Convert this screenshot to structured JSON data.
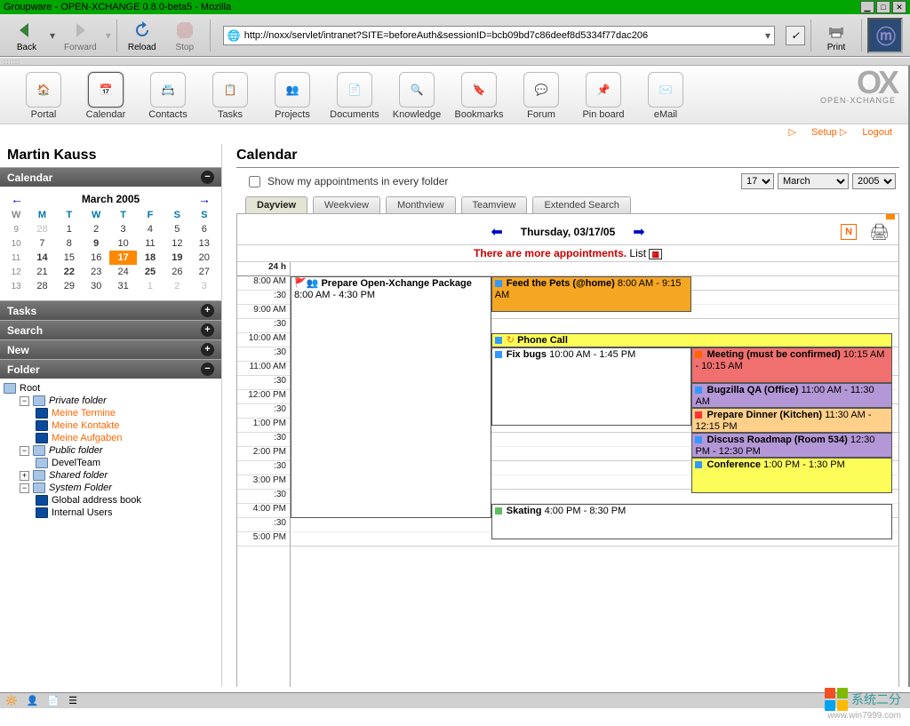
{
  "window": {
    "title": "Groupware - OPEN-XCHANGE 0.8.0-beta5 - Mozilla"
  },
  "browser": {
    "back": "Back",
    "forward": "Forward",
    "reload": "Reload",
    "stop": "Stop",
    "print": "Print",
    "url": "http://noxx/servlet/intranet?SITE=beforeAuth&sessionID=bcb09bd7c86deef8d5334f77dac206"
  },
  "toolbar": {
    "items": [
      {
        "label": "Portal"
      },
      {
        "label": "Calendar"
      },
      {
        "label": "Contacts"
      },
      {
        "label": "Tasks"
      },
      {
        "label": "Projects"
      },
      {
        "label": "Documents"
      },
      {
        "label": "Knowledge"
      },
      {
        "label": "Bookmarks"
      },
      {
        "label": "Forum"
      },
      {
        "label": "Pin board"
      },
      {
        "label": "eMail"
      }
    ],
    "brand": "OX",
    "brand_sub": "OPEN·XCHANGE"
  },
  "meta": {
    "setup": "Setup",
    "logout": "Logout"
  },
  "user": {
    "name": "Martin Kauss"
  },
  "sidebar": {
    "calendar": "Calendar",
    "minical": {
      "title": "March  2005",
      "dow": [
        "W",
        "M",
        "T",
        "W",
        "T",
        "F",
        "S",
        "S"
      ],
      "rows": [
        {
          "wk": "9",
          "d": [
            "28",
            "1",
            "2",
            "3",
            "4",
            "5",
            "6"
          ],
          "out0": true
        },
        {
          "wk": "10",
          "d": [
            "7",
            "8",
            "9",
            "10",
            "11",
            "12",
            "13"
          ],
          "bold": [
            2
          ]
        },
        {
          "wk": "11",
          "d": [
            "14",
            "15",
            "16",
            "17",
            "18",
            "19",
            "20"
          ],
          "bold": [
            0,
            3,
            4,
            5
          ],
          "today": 3
        },
        {
          "wk": "12",
          "d": [
            "21",
            "22",
            "23",
            "24",
            "25",
            "26",
            "27"
          ],
          "bold": [
            1,
            4
          ]
        },
        {
          "wk": "13",
          "d": [
            "28",
            "29",
            "30",
            "31",
            "1",
            "2",
            "3"
          ],
          "out": [
            4,
            5,
            6
          ]
        }
      ]
    },
    "tasks": "Tasks",
    "search": "Search",
    "new": "New",
    "folder": "Folder",
    "tree": {
      "root": "Root",
      "private": "Private folder",
      "meine_termine": "Meine Termine",
      "meine_kontakte": "Meine Kontakte",
      "meine_aufgaben": "Meine Aufgaben",
      "public": "Public folder",
      "develteam": "DevelTeam",
      "shared": "Shared folder",
      "system": "System Folder",
      "gab": "Global address book",
      "internal": "Internal Users"
    }
  },
  "content": {
    "title": "Calendar",
    "show_all": "Show my appointments in every folder",
    "day": "17",
    "month": "March",
    "year": "2005",
    "tabs": [
      "Dayview",
      "Weekview",
      "Monthview",
      "Teamview",
      "Extended Search"
    ],
    "date_label": "Thursday, 03/17/05",
    "more": "There are more appointments.",
    "list": "List",
    "h24": "24 h",
    "times": [
      "8:00 AM",
      ":30",
      "9:00 AM",
      ":30",
      "10:00 AM",
      ":30",
      "11:00 AM",
      ":30",
      "12:00 PM",
      ":30",
      "1:00 PM",
      ":30",
      "2:00 PM",
      ":30",
      "3:00 PM",
      ":30",
      "4:00 PM",
      ":30",
      "5:00 PM"
    ],
    "events": {
      "prepare": {
        "title": "Prepare Open-Xchange Package",
        "time": "8:00 AM - 4:30 PM"
      },
      "feed": {
        "title": "Feed the Pets (@home)",
        "time": "8:00 AM - 9:15 AM"
      },
      "phone": {
        "title": "Phone Call"
      },
      "fix": {
        "title": "Fix bugs",
        "time": "10:00 AM - 1:45 PM"
      },
      "meeting": {
        "title": "Meeting (must be confirmed)",
        "time": "10:15 AM - 10:15 AM"
      },
      "bugzilla": {
        "title": "Bugzilla QA (Office)",
        "time": "11:00 AM - 11:30 AM"
      },
      "dinner": {
        "title": "Prepare Dinner (Kitchen)",
        "time": "11:30 AM - 12:15 PM"
      },
      "roadmap": {
        "title": "Discuss Roadmap (Room 534)",
        "time": "12:30 PM - 12:30 PM"
      },
      "conf": {
        "title": "Conference",
        "time": "1:00 PM - 1:30 PM"
      },
      "skating": {
        "title": "Skating",
        "time": "4:00 PM - 8:30 PM"
      }
    }
  },
  "corner": {
    "url": "www.win7999.com",
    "han": "系统二分"
  }
}
